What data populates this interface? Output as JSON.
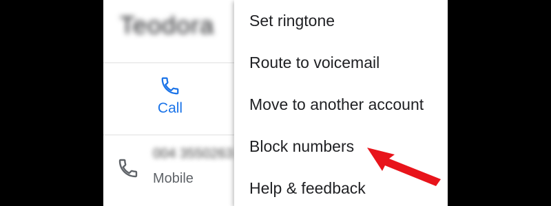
{
  "contact": {
    "name": "Teodora",
    "number_masked": "004 3550263",
    "number_label": "Mobile"
  },
  "actions": {
    "call_label": "Call"
  },
  "menu": {
    "items": [
      {
        "label": "Set ringtone"
      },
      {
        "label": "Route to voicemail"
      },
      {
        "label": "Move to another account"
      },
      {
        "label": "Block numbers"
      },
      {
        "label": "Help & feedback"
      }
    ]
  },
  "colors": {
    "accent": "#1a73e8",
    "annotation_arrow": "#e8141b",
    "text_primary": "#202124",
    "text_secondary": "#5f6368"
  },
  "icons": {
    "call": "phone-icon",
    "row": "phone-icon",
    "annotation": "red-arrow-icon"
  }
}
